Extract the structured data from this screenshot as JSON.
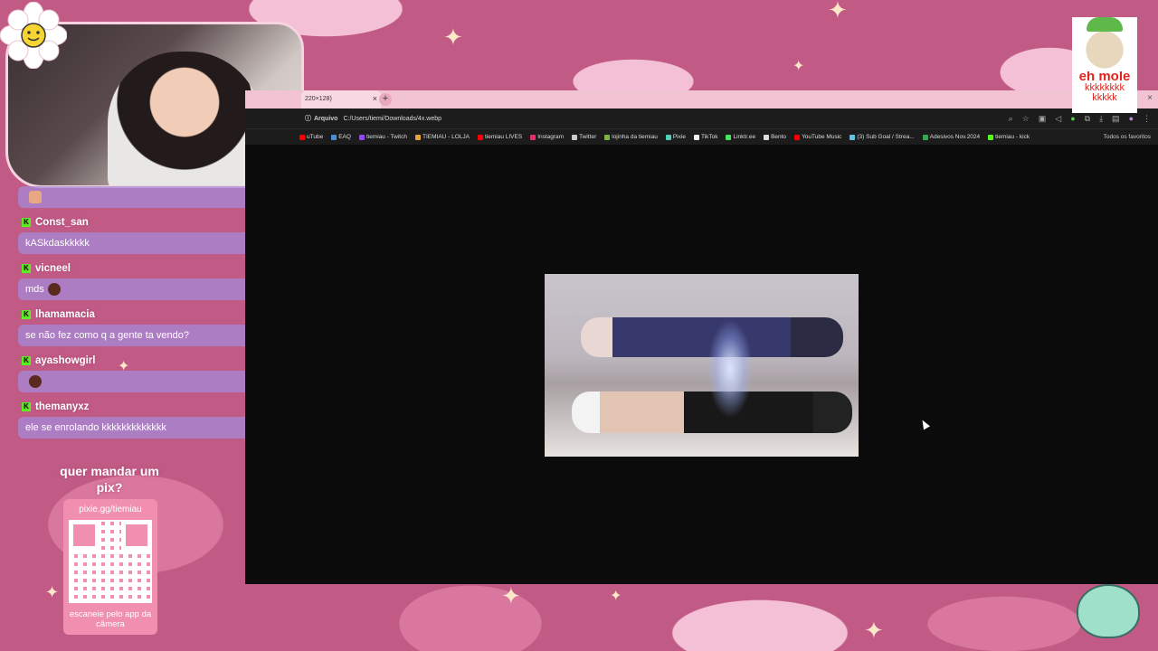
{
  "chat": {
    "messages": [
      {
        "user": "",
        "text": "",
        "emoji": "face"
      },
      {
        "user": "Const_san",
        "text": "kASkdaskkkkk",
        "emoji": ""
      },
      {
        "user": "vicneel",
        "text": "mds",
        "emoji": "dark"
      },
      {
        "user": "lhamamacia",
        "text": "se não fez como q a gente ta vendo?",
        "emoji": ""
      },
      {
        "user": "ayashowgirl",
        "text": "",
        "emoji": "dark"
      },
      {
        "user": "themanyxz",
        "text": "ele se enrolando kkkkkkkkkkkkk",
        "emoji": ""
      }
    ],
    "badge": "K"
  },
  "pix": {
    "title": "quer mandar um pix?",
    "url": "pixie.gg/tiemiau",
    "note": "escaneie pelo app da câmera"
  },
  "browser": {
    "tab_title": "220×128)",
    "url_label": "Arquivo",
    "url": "C:/Users/tiemi/Downloads/4x.webp",
    "bookmarks": [
      {
        "label": "uTube",
        "color": "#ff0000"
      },
      {
        "label": "EAQ",
        "color": "#4a90d9"
      },
      {
        "label": "tiemiau - Twitch",
        "color": "#9146ff"
      },
      {
        "label": "TIEMIAU - LOLJA",
        "color": "#e8a33d"
      },
      {
        "label": "tiemiau LIVES",
        "color": "#ff0000"
      },
      {
        "label": "Instagram",
        "color": "#e1306c"
      },
      {
        "label": "Twitter",
        "color": "#cccccc"
      },
      {
        "label": "lojinha da tiemiau",
        "color": "#7cb342"
      },
      {
        "label": "Pixie",
        "color": "#4dd0c0"
      },
      {
        "label": "TikTok",
        "color": "#eeeeee"
      },
      {
        "label": "Linktr.ee",
        "color": "#43e660"
      },
      {
        "label": "Bento",
        "color": "#dddddd"
      },
      {
        "label": "YouTube Music",
        "color": "#ff0000"
      },
      {
        "label": "(3) Sub Goal / Strea...",
        "color": "#5fc3e4"
      },
      {
        "label": "Adesivos Nov.2024",
        "color": "#34a853"
      },
      {
        "label": "tiemiau - kick",
        "color": "#53fc18"
      }
    ],
    "all_bookmarks": "Todos os favoritos"
  },
  "meme": {
    "line1": "eh mole",
    "line2": "kkkkkkkk",
    "line3": "kkkkk"
  },
  "icons": {
    "new_tab": "+",
    "close": "×"
  },
  "colors": {
    "background": "#c25a86",
    "chat_bubble": "#a489d6",
    "kick_green": "#53fc18",
    "pix_card": "#f08fb0"
  }
}
